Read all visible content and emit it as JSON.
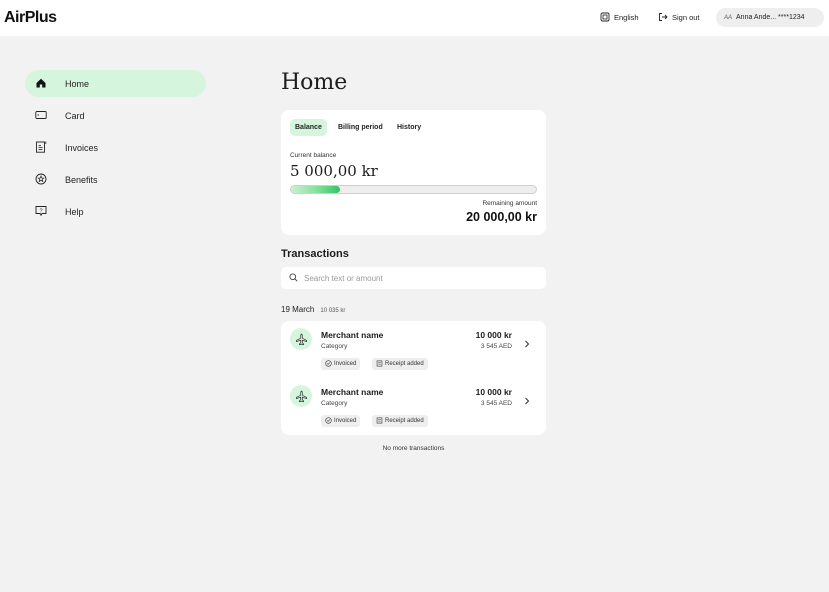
{
  "header": {
    "logo": "AirPlus",
    "language": "English",
    "signout": "Sign out",
    "user_initials": "AA",
    "user_label": "Anna Ande... ****1234"
  },
  "sidebar": {
    "items": [
      {
        "label": "Home",
        "icon": "home-icon",
        "active": true
      },
      {
        "label": "Card",
        "icon": "card-icon",
        "active": false
      },
      {
        "label": "Invoices",
        "icon": "invoice-icon",
        "active": false
      },
      {
        "label": "Benefits",
        "icon": "benefits-icon",
        "active": false
      },
      {
        "label": "Help",
        "icon": "help-icon",
        "active": false
      }
    ]
  },
  "main": {
    "title": "Home",
    "balance": {
      "tabs": [
        {
          "label": "Balance",
          "active": true
        },
        {
          "label": "Billing period",
          "active": false
        },
        {
          "label": "History",
          "active": false
        }
      ],
      "current_label": "Current balance",
      "current_value": "5 000,00 kr",
      "progress_fraction": 0.2,
      "remaining_label": "Remaining amount",
      "remaining_value": "20 000,00 kr"
    },
    "transactions": {
      "title": "Transactions",
      "search_placeholder": "Search text or amount",
      "date_group": {
        "date": "19 March",
        "sum": "10 035 kr"
      },
      "items": [
        {
          "merchant": "Merchant name",
          "category": "Category",
          "amount": "10 000 kr",
          "foreign_amount": "3 545 AED",
          "badges": [
            "Invoiced",
            "Receipt added"
          ],
          "icon": "airplane-icon"
        },
        {
          "merchant": "Merchant name",
          "category": "Category",
          "amount": "10 000 kr",
          "foreign_amount": "3 545 AED",
          "badges": [
            "Invoiced",
            "Receipt added"
          ],
          "icon": "airplane-icon"
        }
      ],
      "end_text": "No more transactions"
    }
  },
  "colors": {
    "accent_light": "#d6f5dd",
    "accent": "#2fc463",
    "background": "#f2f2f2",
    "surface": "#ffffff"
  }
}
